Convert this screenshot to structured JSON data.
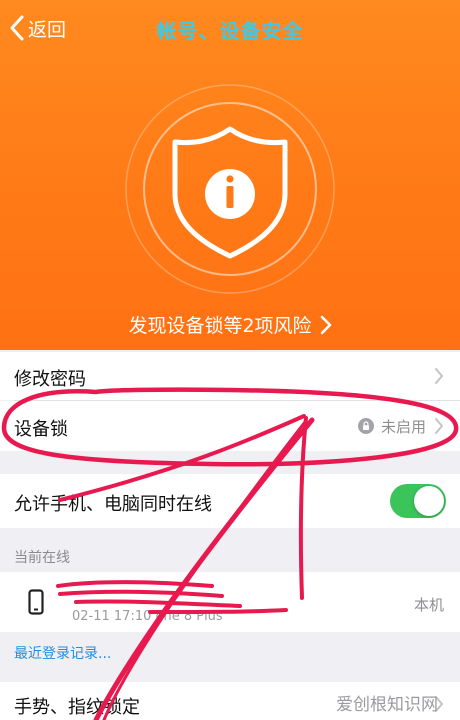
{
  "nav": {
    "back_label": "返回",
    "title": "帐号、设备安全"
  },
  "hero": {
    "risk_text": "发现设备锁等2项风险"
  },
  "settings": {
    "change_password": "修改密码",
    "device_lock": "设备锁",
    "device_lock_status": "未启用",
    "allow_online": "允许手机、电脑同时在线",
    "allow_online_on": true
  },
  "online": {
    "section_title": "当前在线",
    "device_time": "02-11 17:10   one 8 Plus",
    "device_tag": "本机",
    "recent_login_link": "最近登录记录..."
  },
  "bottom": {
    "gesture_lock": "手势、指纹锁定"
  },
  "watermark": "爱创根知识网",
  "colors": {
    "hero_orange": "#ff7a17",
    "title_cyan": "#3fc9e6",
    "toggle_green": "#3ac45a",
    "link_blue": "#1f8ee6",
    "annotation_red": "#e8194f"
  }
}
